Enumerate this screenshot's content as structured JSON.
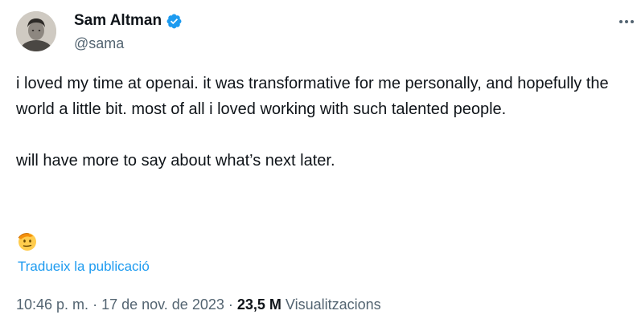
{
  "author": {
    "display_name": "Sam Altman",
    "handle": "@sama",
    "verified": true,
    "verified_color": "#1d9bf0"
  },
  "tweet": {
    "paragraphs": [
      "i loved my time at openai. it was transformative for me personally, and hopefully the world a little bit. most of all i loved working with such talented people.",
      "will have more to say about what’s next later."
    ],
    "emoji": "saluting-face-icon"
  },
  "translate_label": "Tradueix la publicació",
  "meta": {
    "time": "10:46 p. m.",
    "separator": "·",
    "date": "17 de nov. de 2023",
    "views_count": "23,5 M",
    "views_label": "Visualitzacions"
  },
  "colors": {
    "text": "#0f1419",
    "secondary": "#536471",
    "link": "#1d9bf0"
  }
}
